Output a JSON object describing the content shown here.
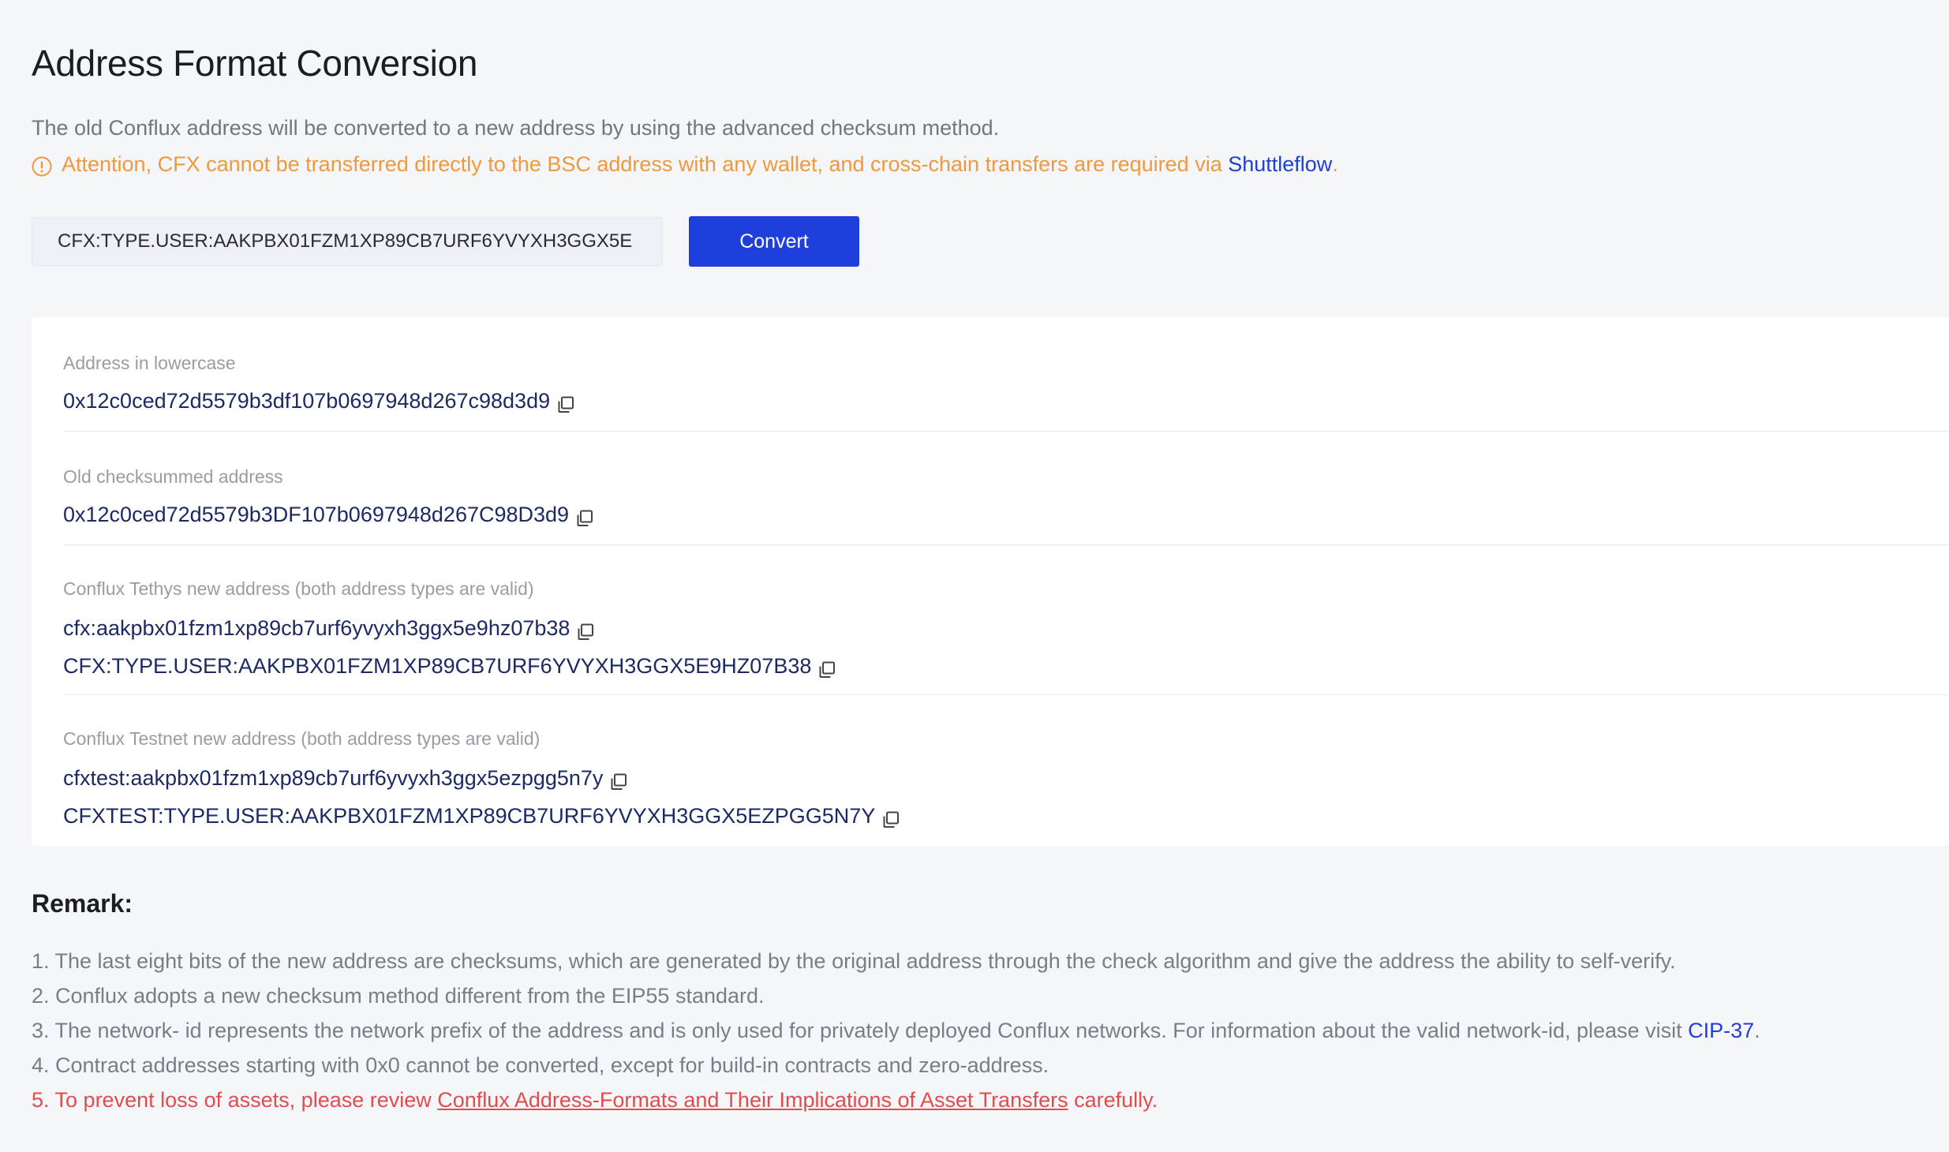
{
  "page": {
    "title": "Address Format Conversion",
    "description": "The old Conflux address will be converted to a new address by using the advanced checksum method.",
    "attention": {
      "text": "Attention, CFX cannot be transferred directly to the BSC address with any wallet, and cross-chain transfers are required via ",
      "link_label": "Shuttleflow",
      "suffix": ".",
      "icon": "exclamation-circle-icon",
      "color": "#f1993a"
    }
  },
  "converter": {
    "input_value": "CFX:TYPE.USER:AAKPBX01FZM1XP89CB7URF6YVYXH3GGX5E",
    "button_label": "Convert",
    "button_color": "#1e3fdc"
  },
  "results": [
    {
      "label": "Address in lowercase",
      "addresses": [
        "0x12c0ced72d5579b3df107b0697948d267c98d3d9"
      ]
    },
    {
      "label": "Old checksummed address",
      "addresses": [
        "0x12c0ced72d5579b3DF107b0697948d267C98D3d9"
      ]
    },
    {
      "label": "Conflux Tethys new address (both address types are valid)",
      "addresses": [
        "cfx:aakpbx01fzm1xp89cb7urf6yvyxh3ggx5e9hz07b38",
        "CFX:TYPE.USER:AAKPBX01FZM1XP89CB7URF6YVYXH3GGX5E9HZ07B38"
      ]
    },
    {
      "label": "Conflux Testnet new address (both address types are valid)",
      "addresses": [
        "cfxtest:aakpbx01fzm1xp89cb7urf6yvyxh3ggx5ezpgg5n7y",
        "CFXTEST:TYPE.USER:AAKPBX01FZM1XP89CB7URF6YVYXH3GGX5EZPGG5N7Y"
      ]
    }
  ],
  "copy_icon": "copy-icon",
  "remark": {
    "title": "Remark:",
    "items": [
      {
        "text": "1. The last eight bits of the new address are checksums, which are generated by the original address through the check algorithm and give the address the ability to self-verify."
      },
      {
        "text": "2. Conflux adopts a new checksum method different from the EIP55 standard."
      },
      {
        "text": "3. The network- id represents the network prefix of the address and is only used for privately deployed Conflux networks. For information about the valid network-id, please visit ",
        "link": "CIP-37",
        "suffix": "."
      },
      {
        "text": "4. Contract addresses starting with 0x0 cannot be converted, except for build-in contracts and zero-address."
      },
      {
        "text": "5. To prevent loss of assets, please review ",
        "link": "Conflux Address-Formats and Their Implications of Asset Transfers",
        "suffix": " carefully.",
        "danger": true
      }
    ]
  }
}
